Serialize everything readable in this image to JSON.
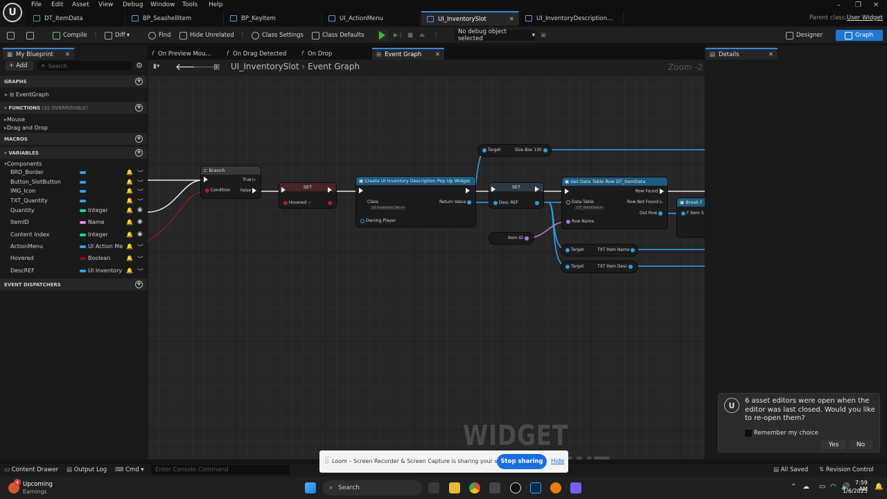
{
  "menu": [
    "File",
    "Edit",
    "Asset",
    "View",
    "Debug",
    "Window",
    "Tools",
    "Help"
  ],
  "logo": "U",
  "tabs": [
    {
      "label": "DT_ItemData",
      "active": false
    },
    {
      "label": "BP_SeashellItem",
      "active": false
    },
    {
      "label": "BP_KeyItem",
      "active": false
    },
    {
      "label": "UI_ActionMenu",
      "active": false
    },
    {
      "label": "UI_InventorySlot",
      "active": true
    },
    {
      "label": "UI_InventoryDescription...",
      "active": false
    }
  ],
  "parent_class": {
    "label": "Parent class:",
    "value": "User Widget"
  },
  "toolbar": {
    "compile": "Compile",
    "diff": "Diff",
    "find": "Find",
    "hide_unrelated": "Hide Unrelated",
    "class_settings": "Class Settings",
    "class_defaults": "Class Defaults",
    "debug_select": "No debug object selected",
    "designer": "Designer",
    "graph": "Graph"
  },
  "my_blueprint": {
    "title": "My Blueprint",
    "add": "Add",
    "search_placeholder": "Search",
    "graphs_header": "GRAPHS",
    "event_graph": "EventGraph",
    "functions_header": "FUNCTIONS",
    "functions_count": "(32 OVERRIDABLE)",
    "function_items": [
      "Mouse",
      "Drag and Drop"
    ],
    "macros_header": "MACROS",
    "variables_header": "VARIABLES",
    "components_label": "Components",
    "components": [
      "BRD_Border",
      "Button_SlotButton",
      "IMG_Icon",
      "TXT_Quantity"
    ],
    "variables": [
      {
        "name": "Quantity",
        "type": "Integer",
        "color": "#1fd6a0",
        "eye": true
      },
      {
        "name": "ItemID",
        "type": "Name",
        "color": "#d98ff0",
        "eye": true
      },
      {
        "name": "Content Index",
        "type": "Integer",
        "color": "#1fd6a0",
        "eye": true
      },
      {
        "name": "ActionMenu",
        "type": "UI Action Me",
        "color": "#2aa6ea",
        "eye": false
      },
      {
        "name": "Hovered",
        "type": "Boolean",
        "color": "#8b0e0e",
        "eye": false
      },
      {
        "name": "DescREF",
        "type": "UI Inventory",
        "color": "#2aa6ea",
        "eye": false
      }
    ],
    "event_dispatchers_header": "EVENT DISPATCHERS"
  },
  "graph_tabs": [
    "On Preview Mou...",
    "On Drag Detected",
    "On Drop",
    "Event Graph"
  ],
  "breadcrumb": {
    "root": "UI_InventorySlot",
    "current": "Event Graph"
  },
  "zoom": "Zoom -2",
  "nodes": {
    "branch": {
      "title": "Branch",
      "true": "True",
      "condition": "Condition",
      "false": "False"
    },
    "set_hovered": {
      "title": "SET",
      "pin": "Hovered"
    },
    "create_widget": {
      "title": "Create UI Inventory Description Pop Up Widget",
      "class": "Class",
      "class_value": "UI Inventory Des",
      "return_value": "Return Value",
      "owning_player": "Owning Player"
    },
    "target_size_box": {
      "target": "Target",
      "value": "Size Box 130"
    },
    "set_desc": {
      "title": "SET",
      "pin": "Desc REF"
    },
    "get_data_table_row": {
      "title": "Get Data Table Row DT_ItemData",
      "data_table": "Data Table",
      "data_table_value": "DT_ItemData",
      "row_name": "Row Name",
      "row_found": "Row Found",
      "row_not_found": "Row Not Found",
      "out_row": "Out Row"
    },
    "item_id": "Item ID",
    "txt_name": {
      "target": "Target",
      "value": "TXT Item Name"
    },
    "txt_desc": {
      "target": "Target",
      "value": "TXT Item Desc"
    },
    "break": {
      "title": "Break F",
      "pin": "F Item S"
    }
  },
  "watermark": "WIDGET BLUEPRINT",
  "details": {
    "title": "Details"
  },
  "toast": {
    "message": "6 asset editors were open when the editor was last closed. Would you like to re-open them?",
    "remember": "Remember my choice",
    "yes": "Yes",
    "no": "No"
  },
  "statusbar": {
    "content_drawer": "Content Drawer",
    "output_log": "Output Log",
    "cmd": "Cmd",
    "console_placeholder": "Enter Console Command",
    "all_saved": "All Saved",
    "revision_control": "Revision Control"
  },
  "loom": {
    "message": "Loom – Screen Recorder & Screen Capture is sharing your screen.",
    "stop": "Stop sharing",
    "hide": "Hide"
  },
  "taskbar": {
    "weather_badge": "4",
    "weather_title": "Upcoming",
    "weather_sub": "Earnings",
    "search": "Search",
    "time": "7:59 AM",
    "date": "1/6/2025"
  }
}
